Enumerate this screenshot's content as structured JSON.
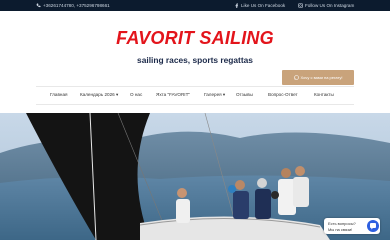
{
  "topbar": {
    "phone_text": "+36261744780, +375296798661",
    "facebook_text": "Like Us On Facebook",
    "instagram_text": "Follow Us On Instagram"
  },
  "header": {
    "logo_text": "FAVORIT SAILING",
    "tagline": "sailing races, sports regattas"
  },
  "whatsapp_button": {
    "label": "Хочу с вами на регату!"
  },
  "nav": {
    "items": [
      {
        "label": "Главная"
      },
      {
        "label": "Календарь 2026 ▾"
      },
      {
        "label": "О нас"
      },
      {
        "label": "Яхта \"FAVORIT\""
      },
      {
        "label": "Галерея ▾"
      },
      {
        "label": "Отзывы"
      },
      {
        "label": "Вопрос-Ответ"
      },
      {
        "label": "Контакты"
      }
    ]
  },
  "chat_widget": {
    "line1": "Есть вопросы?",
    "line2": "Мы на связи!"
  },
  "colors": {
    "brand_red": "#e3141b",
    "topbar_bg": "#0c1b2e",
    "accent_gold": "#c9a37b",
    "chat_blue": "#2d5fe0"
  }
}
